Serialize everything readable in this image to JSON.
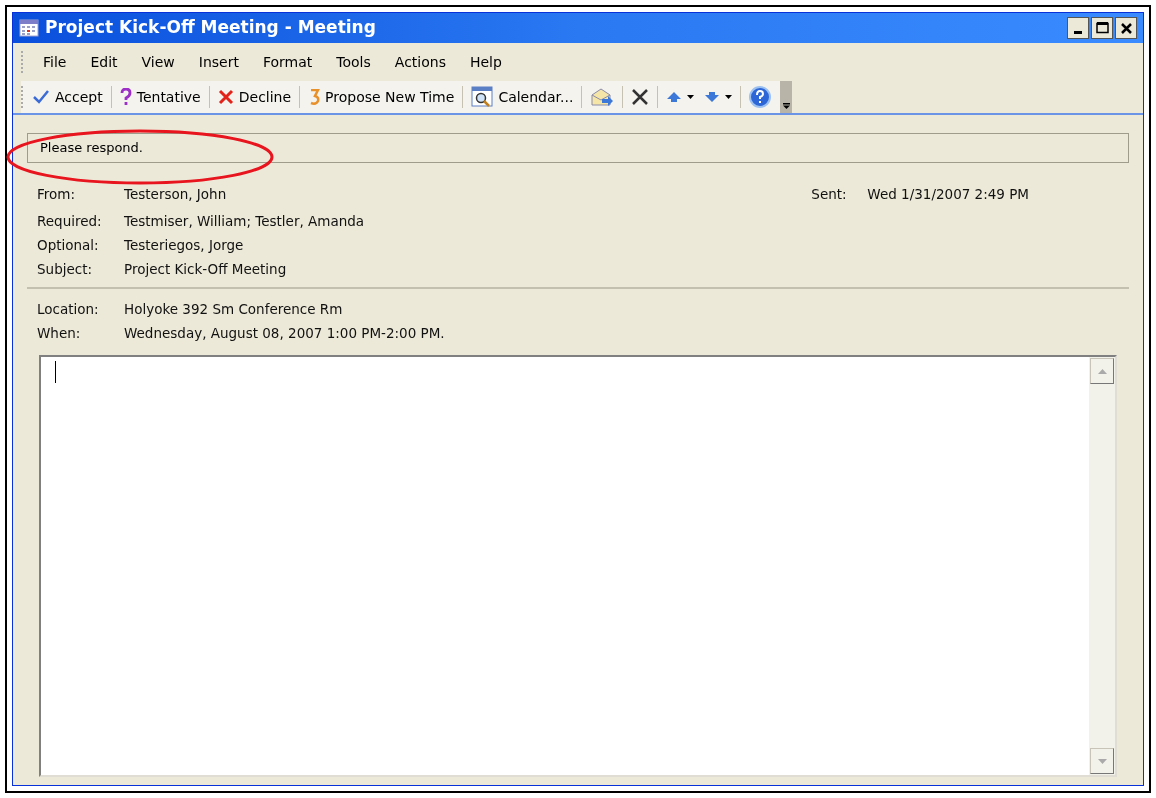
{
  "window": {
    "title": "Project Kick-Off Meeting - Meeting"
  },
  "menu": [
    "File",
    "Edit",
    "View",
    "Insert",
    "Format",
    "Tools",
    "Actions",
    "Help"
  ],
  "toolbar": [
    [
      {
        "label": "Accept",
        "dropdown": false
      }
    ],
    [
      {
        "label": "Tentative",
        "dropdown": false
      }
    ],
    [
      {
        "label": "Decline",
        "dropdown": false
      }
    ],
    [
      {
        "label": "Propose New Time",
        "dropdown": false
      }
    ],
    [
      {
        "label": "Calendar...",
        "dropdown": false
      }
    ],
    [
      {
        "dropdown": false
      }
    ],
    [
      {
        "dropdown": false
      }
    ],
    [
      {
        "dropdown": true
      },
      {
        "dropdown": true
      }
    ],
    [
      {
        "dropdown": false
      }
    ]
  ],
  "info_bar": "Please respond.",
  "header": {
    "from_label": "From:",
    "from": "Testerson,  John",
    "sent_label": "Sent:",
    "sent": "Wed 1/31/2007 2:49 PM",
    "fields": [
      {
        "label": "Required:",
        "value": "Testmiser,  William; Testler,  Amanda"
      },
      {
        "label": "Optional:",
        "value": "Testeriegos,  Jorge"
      },
      {
        "label": "Subject:",
        "value": "Project Kick-Off Meeting"
      }
    ],
    "details": [
      {
        "label": "Location:",
        "value": "Holyoke 392 Sm Conference Rm"
      },
      {
        "label": "When:",
        "value": "Wednesday, August 08, 2007 1:00 PM-2:00 PM."
      }
    ]
  },
  "annotations": [
    {
      "kind": "ellipse",
      "color": "#e8141e"
    }
  ]
}
